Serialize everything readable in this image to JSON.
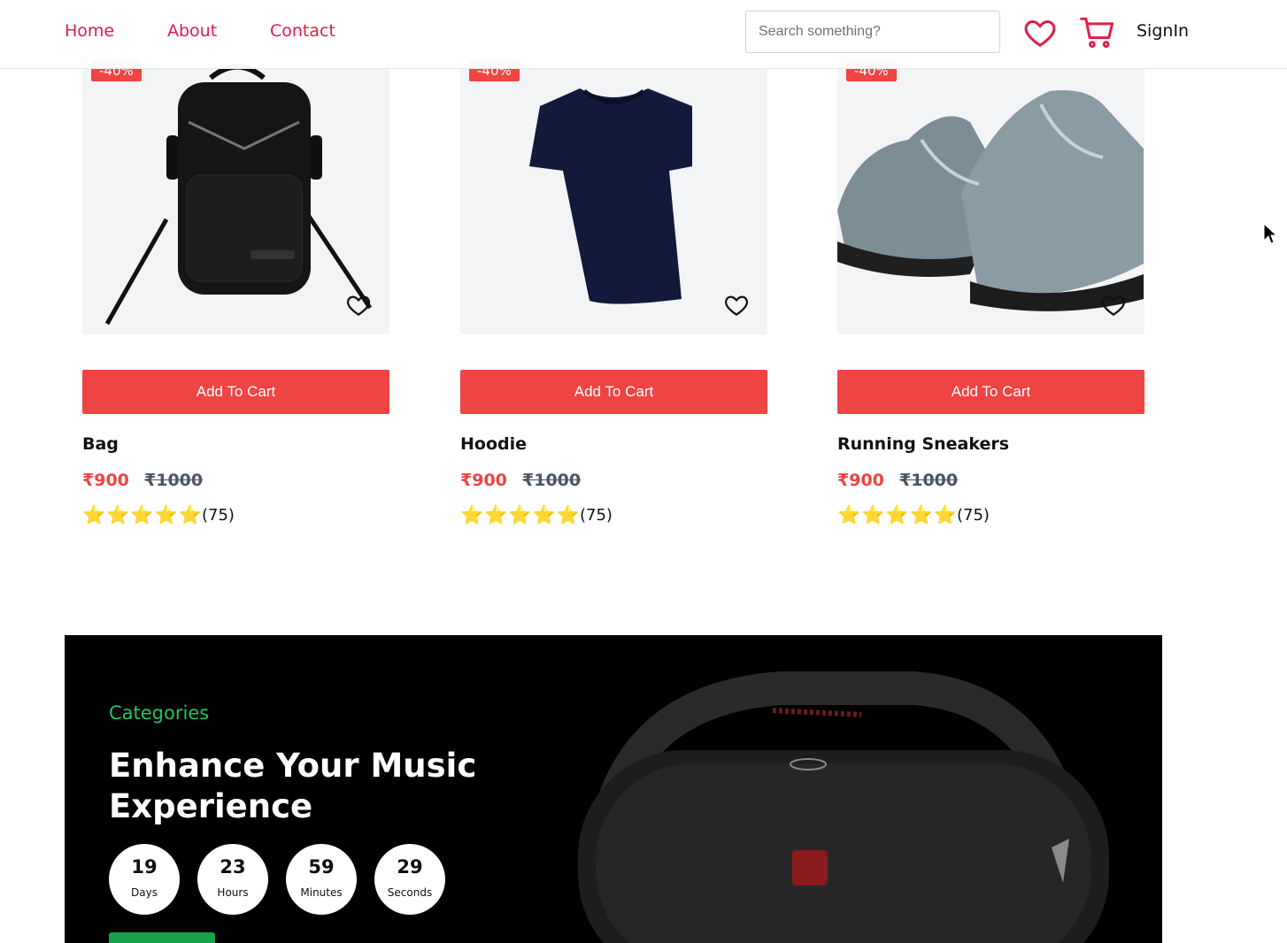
{
  "header": {
    "nav": [
      {
        "label": "Home"
      },
      {
        "label": "About"
      },
      {
        "label": "Contact"
      }
    ],
    "search_placeholder": "Search something?",
    "signin_label": "SignIn",
    "icons": [
      "heart-icon",
      "cart-icon"
    ]
  },
  "products": [
    {
      "name": "Bag",
      "badge": "-40%",
      "add_to_cart": "Add To Cart",
      "price": "₹900",
      "old_price": "₹1000",
      "rating": 5,
      "stars": "⭐⭐⭐⭐⭐",
      "reviews": "(75)"
    },
    {
      "name": "Hoodie",
      "badge": "-40%",
      "add_to_cart": "Add To Cart",
      "price": "₹900",
      "old_price": "₹1000",
      "rating": 5,
      "stars": "⭐⭐⭐⭐⭐",
      "reviews": "(75)"
    },
    {
      "name": "Running Sneakers",
      "badge": "-40%",
      "add_to_cart": "Add To Cart",
      "price": "₹900",
      "old_price": "₹1000",
      "rating": 5,
      "stars": "⭐⭐⭐⭐⭐",
      "reviews": "(75)"
    }
  ],
  "banner": {
    "category": "Categories",
    "title": "Enhance Your Music Experience",
    "timer": [
      {
        "value": "19",
        "label": "Days"
      },
      {
        "value": "23",
        "label": "Hours"
      },
      {
        "value": "59",
        "label": "Minutes"
      },
      {
        "value": "29",
        "label": "Seconds"
      }
    ]
  },
  "colors": {
    "accent": "#ef4444",
    "nav_link": "#e11d48",
    "banner_bg": "#000000",
    "category": "#22c55e"
  }
}
